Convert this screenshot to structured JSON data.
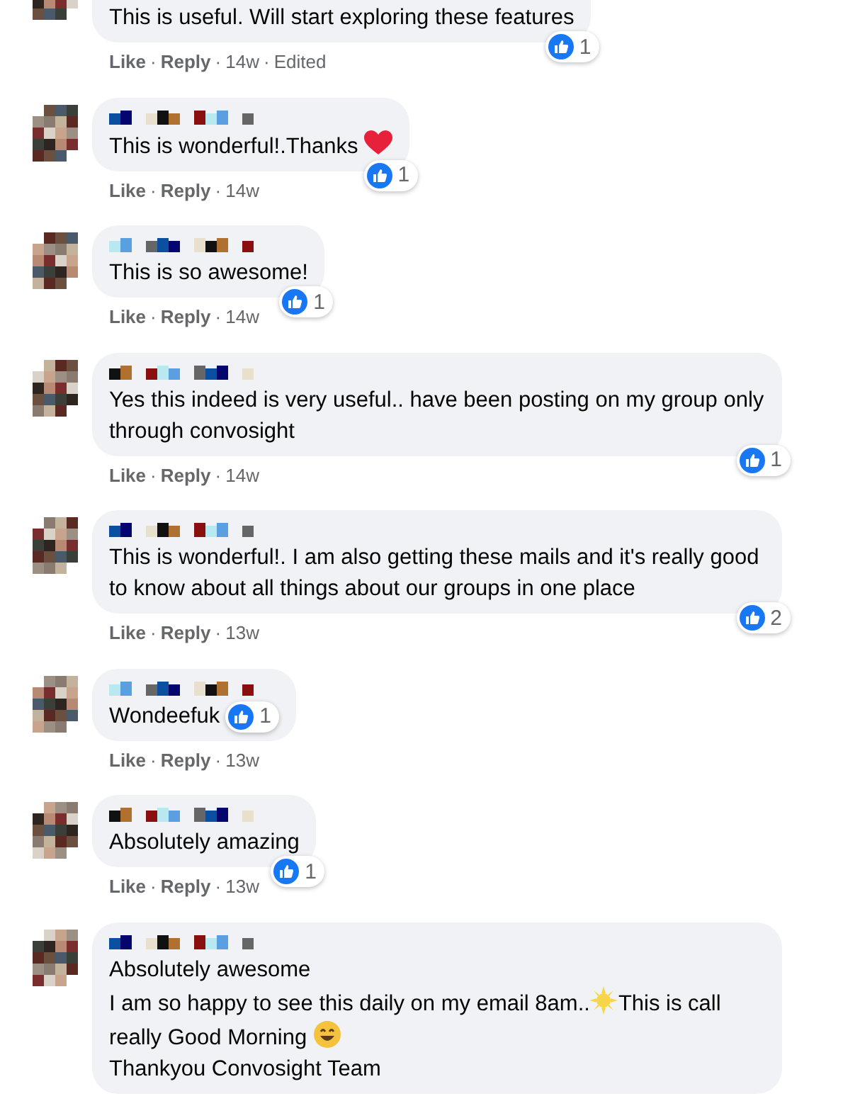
{
  "comments": [
    {
      "lines": [
        [
          {
            "kind": "text",
            "text": "This is useful. Will start exploring these features"
          }
        ]
      ],
      "actions": {
        "like": "Like",
        "reply": "Reply",
        "time": "14w",
        "edited": "Edited",
        "separator": "·"
      },
      "reactions": "1",
      "badge_inline": false,
      "name_blurred": false
    },
    {
      "lines": [
        [
          {
            "kind": "text",
            "text": "This is wonderful!.Thanks "
          },
          {
            "kind": "heart-emoji"
          }
        ]
      ],
      "actions": {
        "like": "Like",
        "reply": "Reply",
        "time": "14w",
        "separator": "·"
      },
      "reactions": "1",
      "badge_inline": false,
      "name_blurred": true
    },
    {
      "lines": [
        [
          {
            "kind": "text",
            "text": "This is so awesome!"
          }
        ]
      ],
      "actions": {
        "like": "Like",
        "reply": "Reply",
        "time": "14w",
        "separator": "·"
      },
      "reactions": "1",
      "badge_inline": false,
      "name_blurred": true
    },
    {
      "lines": [
        [
          {
            "kind": "text",
            "text": "Yes this indeed is very useful.. have been posting on my group only through convosight"
          }
        ]
      ],
      "actions": {
        "like": "Like",
        "reply": "Reply",
        "time": "14w",
        "separator": "·"
      },
      "reactions": "1",
      "badge_inline": false,
      "name_blurred": true
    },
    {
      "lines": [
        [
          {
            "kind": "text",
            "text": "This is wonderful!. I am also getting these mails and it's really good to know about all things about our groups in one place"
          }
        ]
      ],
      "actions": {
        "like": "Like",
        "reply": "Reply",
        "time": "13w",
        "separator": "·"
      },
      "reactions": "2",
      "badge_inline": false,
      "name_blurred": true
    },
    {
      "lines": [
        [
          {
            "kind": "text",
            "text": "Wondeefuk"
          }
        ]
      ],
      "actions": {
        "like": "Like",
        "reply": "Reply",
        "time": "13w",
        "separator": "·"
      },
      "reactions": "1",
      "badge_inline": true,
      "name_blurred": true
    },
    {
      "lines": [
        [
          {
            "kind": "text",
            "text": "Absolutely amazing"
          }
        ]
      ],
      "actions": {
        "like": "Like",
        "reply": "Reply",
        "time": "13w",
        "separator": "·"
      },
      "reactions": "1",
      "badge_inline": false,
      "name_blurred": true
    },
    {
      "lines": [
        [
          {
            "kind": "text",
            "text": "Absolutely awesome"
          }
        ],
        [
          {
            "kind": "text",
            "text": "I am so happy to see this daily on my email 8am.."
          },
          {
            "kind": "sun-emoji"
          },
          {
            "kind": "text",
            "text": "This is call really Good Morning "
          },
          {
            "kind": "grin-emoji"
          }
        ],
        [
          {
            "kind": "text",
            "text": "Thankyou Convosight Team"
          }
        ]
      ],
      "name_blurred": true
    }
  ]
}
